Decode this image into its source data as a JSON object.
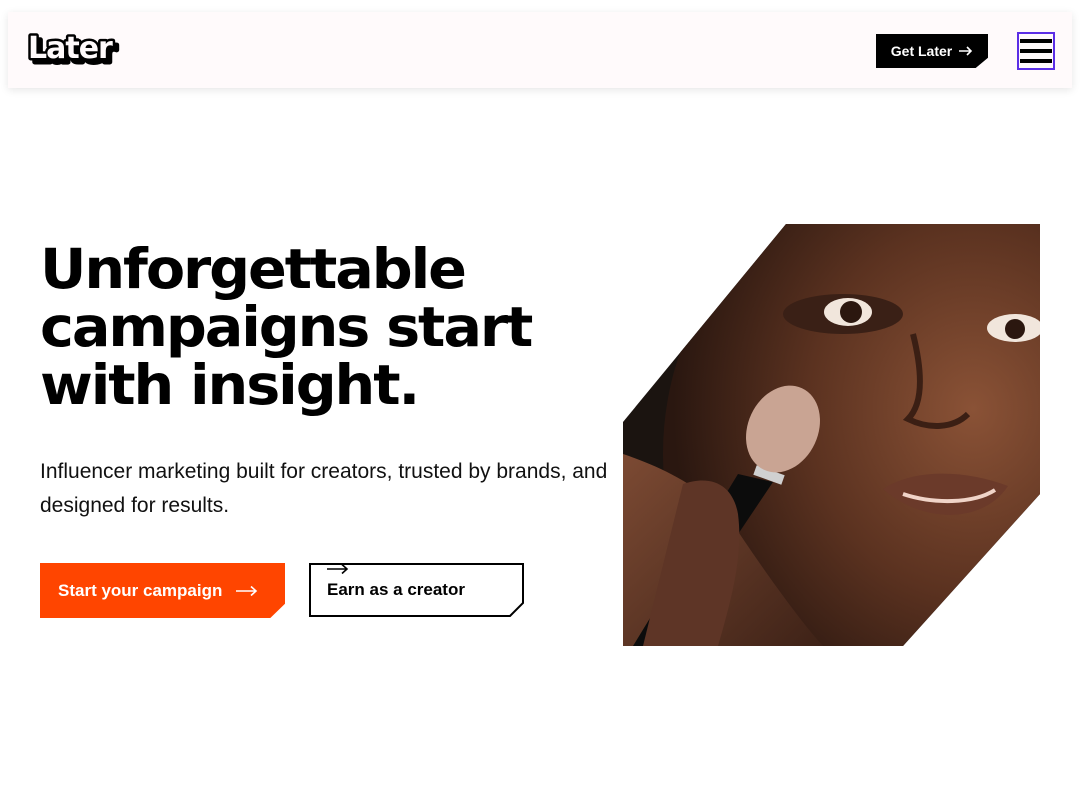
{
  "header": {
    "logo_text": "Later",
    "get_later_label": "Get Later",
    "menu_icon": "hamburger-menu-icon"
  },
  "hero": {
    "headline_lines": [
      "Unforgettable",
      "campaigns start",
      "with insight."
    ],
    "subheadline": "Influencer marketing built for creators, trusted by brands, and designed for results.",
    "primary_cta": "Start your campaign",
    "secondary_cta": "Earn as a creator",
    "image_alt": "Woman applying makeup with a brush"
  },
  "colors": {
    "accent_orange": "#ff4500",
    "menu_outline": "#5b2ee6",
    "header_bg": "#fffafb"
  }
}
